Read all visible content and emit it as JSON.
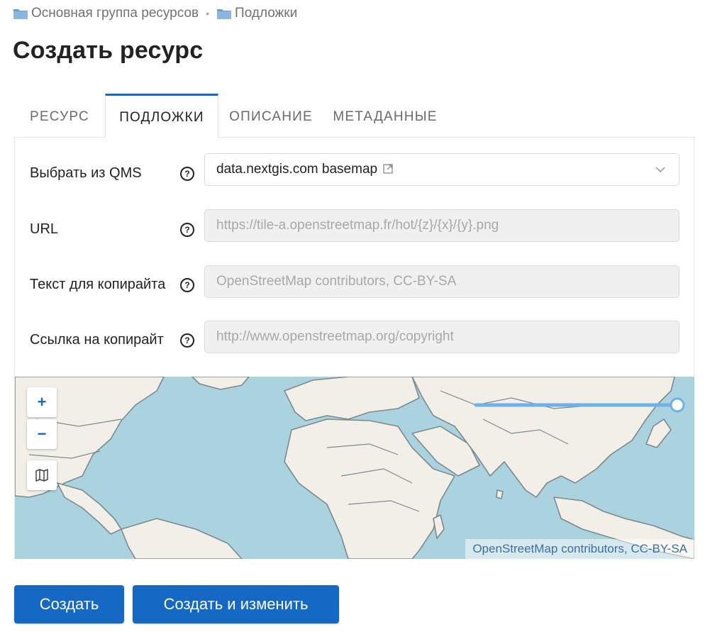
{
  "breadcrumb": [
    {
      "label": "Основная группа ресурсов"
    },
    {
      "label": "Подложки"
    }
  ],
  "page_title": "Создать ресурс",
  "tabs": [
    {
      "label": "РЕСУРС",
      "active": false
    },
    {
      "label": "ПОДЛОЖКИ",
      "active": true
    },
    {
      "label": "ОПИСАНИЕ",
      "active": false
    },
    {
      "label": "МЕТАДАННЫЕ",
      "active": false
    }
  ],
  "form": {
    "qms": {
      "label": "Выбрать из QMS",
      "value": "data.nextgis.com basemap"
    },
    "url": {
      "label": "URL",
      "placeholder": "https://tile-a.openstreetmap.fr/hot/{z}/{x}/{y}.png"
    },
    "copyright_text": {
      "label": "Текст для копирайта",
      "placeholder": "OpenStreetMap contributors, CC-BY-SA"
    },
    "copyright_url": {
      "label": "Ссылка на копирайт",
      "placeholder": "http://www.openstreetmap.org/copyright"
    },
    "help_glyph": "?"
  },
  "map": {
    "zoom_in": "+",
    "zoom_out": "−",
    "attribution": "OpenStreetMap contributors, CC-BY-SA",
    "colors": {
      "water": "#aad3df",
      "land": "#f2efe9",
      "borders": "#7c8a8c",
      "line": "#6fb0e8"
    }
  },
  "actions": {
    "create": "Создать",
    "create_and_edit": "Создать и изменить"
  },
  "colors": {
    "accent": "#1568c3"
  },
  "icons": [
    "folder-icon",
    "question-circle-icon",
    "external-link-icon",
    "chevron-down-icon",
    "map-icon"
  ]
}
